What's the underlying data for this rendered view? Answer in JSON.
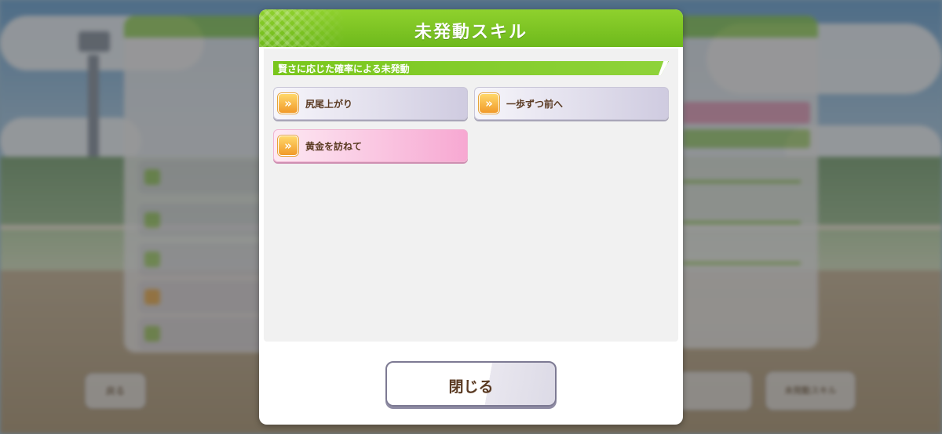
{
  "dialog": {
    "title": "未発動スキル",
    "section_label": "賢さに応じた確率による未発動",
    "close_label": "閉じる"
  },
  "skills": [
    {
      "name": "尻尾上がり",
      "rarity": "normal",
      "icon": "speed-skill-icon"
    },
    {
      "name": "一歩ずつ前へ",
      "rarity": "normal",
      "icon": "speed-skill-icon"
    },
    {
      "name": "黄金を訪ねて",
      "rarity": "gold",
      "icon": "speed-skill-icon"
    }
  ],
  "background": {
    "left_back_label": "戻る",
    "right_button_2": "未発動スキル"
  },
  "colors": {
    "header_green": "#7bc322",
    "skill_gold": "#f7a8d2",
    "skill_normal": "#cfcbe0",
    "label_brown": "#5a3a22"
  }
}
